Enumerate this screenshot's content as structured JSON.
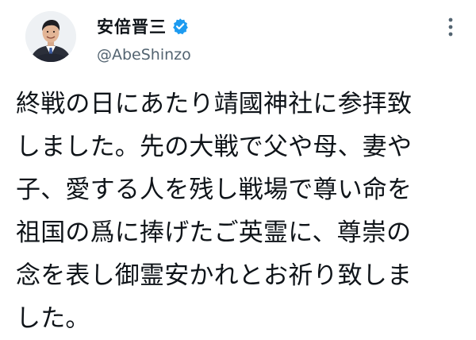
{
  "author": {
    "display_name": "安倍晋三",
    "handle": "@AbeShinzo",
    "verified_icon": "verified-badge-icon",
    "verified_color": "#1d9bf0",
    "avatar_icon": "profile-photo"
  },
  "more_icon": "more-options-icon",
  "tweet": {
    "lines": [
      "終戦の日にあたり靖國神社に参拝致",
      "しました。先の大戦で父や母、妻や",
      "子、愛する人を残し戦場で尊い命を",
      "祖国の爲に捧げたご英霊に、尊崇の",
      "念を表し御霊安かれとお祈り致しま",
      "した。"
    ]
  },
  "colors": {
    "text": "#0f1419",
    "secondary_text": "#536471",
    "background": "#ffffff"
  }
}
